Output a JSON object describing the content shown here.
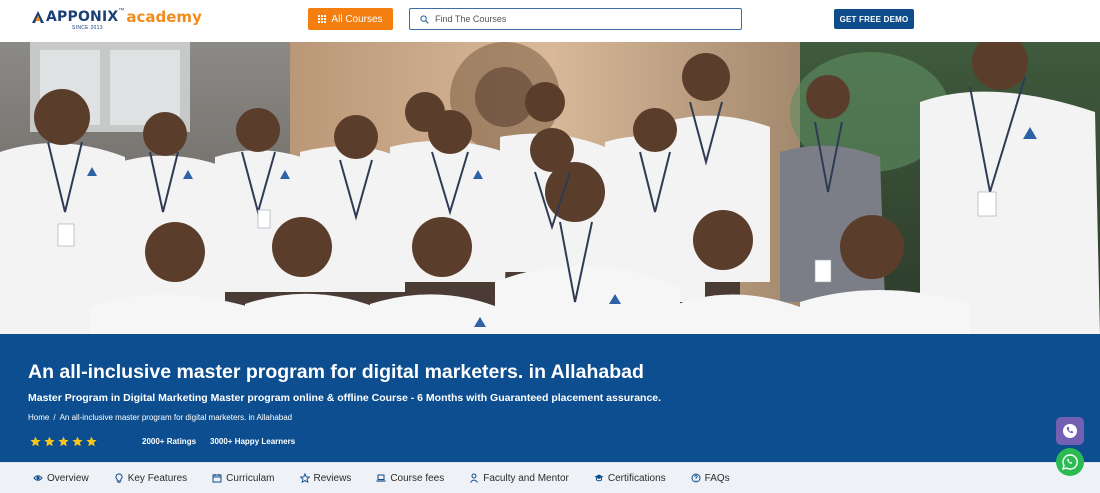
{
  "header": {
    "logo_text": "APPONIX",
    "logo_tm": "™",
    "logo_accent": "academy",
    "logo_since": "SINCE 2013",
    "all_courses_label": "All Courses",
    "search_placeholder": "Find The Courses",
    "demo_label": "GET FREE DEMO"
  },
  "hero": {
    "title": "An all-inclusive master program for digital marketers. in Allahabad",
    "subtitle": "Master Program in Digital Marketing Master program online & offline Course - 6 Months with Guaranteed placement assurance.",
    "breadcrumb": {
      "home": "Home",
      "separator": "/",
      "current": "An all-inclusive master program for digital marketers. in Allahabad"
    },
    "rating_stars": 5,
    "ratings_text": "2000+ Ratings",
    "learners_text": "3000+ Happy Learners"
  },
  "tabs": [
    {
      "label": "Overview",
      "icon": "eye-icon"
    },
    {
      "label": "Key Features",
      "icon": "bulb-icon"
    },
    {
      "label": "Curriculam",
      "icon": "calendar-icon"
    },
    {
      "label": "Reviews",
      "icon": "star-icon"
    },
    {
      "label": "Course fees",
      "icon": "laptop-icon"
    },
    {
      "label": "Faculty and Mentor",
      "icon": "user-icon"
    },
    {
      "label": "Certifications",
      "icon": "graduation-cap-icon"
    },
    {
      "label": "FAQs",
      "icon": "question-circle-icon"
    }
  ],
  "colors": {
    "brand_blue": "#0c4e90",
    "brand_orange": "#f47e0f",
    "whatsapp_green": "#2bbb52",
    "phone_purple": "#7360b3"
  }
}
